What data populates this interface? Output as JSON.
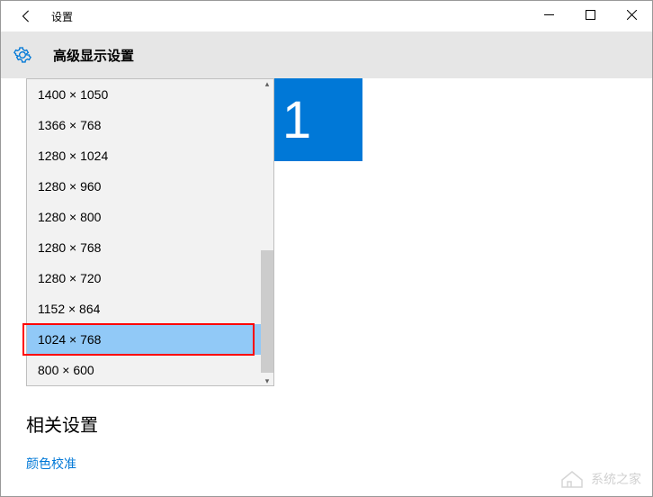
{
  "window": {
    "title": "设置"
  },
  "header": {
    "heading": "高级显示设置"
  },
  "monitor": {
    "id": "1"
  },
  "resolution_dropdown": {
    "items": [
      "1400 × 1050",
      "1366 × 768",
      "1280 × 1024",
      "1280 × 960",
      "1280 × 800",
      "1280 × 768",
      "1280 × 720",
      "1152 × 864",
      "1024 × 768",
      "800 × 600"
    ],
    "selected_index": 8
  },
  "related": {
    "heading": "相关设置",
    "link_color_calibration": "颜色校准"
  },
  "watermark": {
    "text": "系统之家"
  }
}
